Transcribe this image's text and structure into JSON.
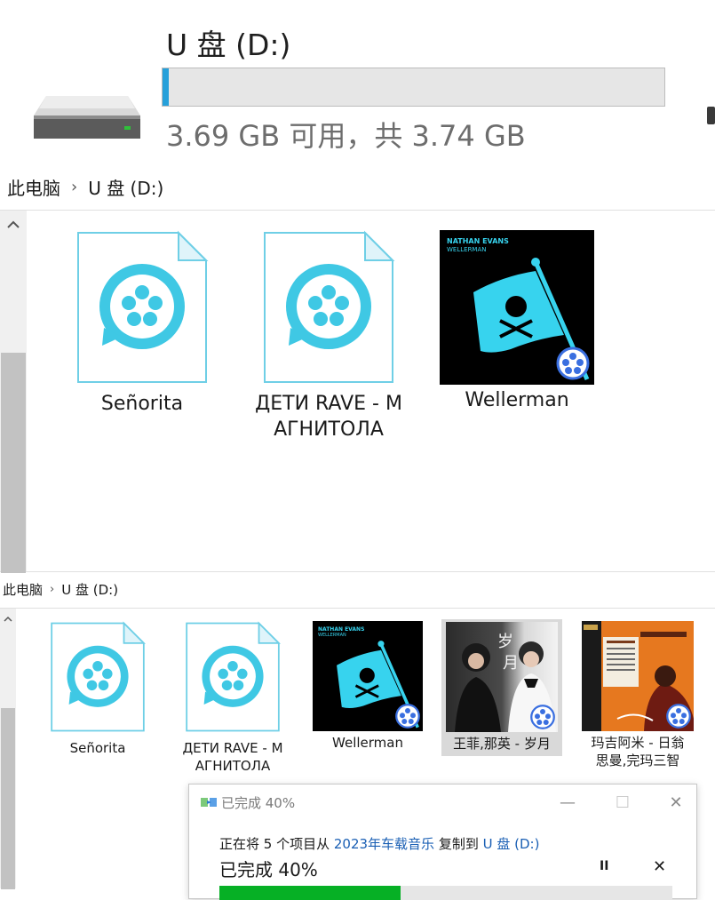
{
  "drive": {
    "title": "U 盘 (D:)",
    "space_text": "3.69 GB 可用，共 3.74 GB",
    "used_fraction": 0.013
  },
  "breadcrumb_top": {
    "root": "此电脑",
    "sep": "›",
    "current": "U 盘 (D:)"
  },
  "pane_top": {
    "items": [
      {
        "name": "Señorita",
        "icon": "video-file-icon"
      },
      {
        "name": "ДЕТИ RAVE - МАГНИТОЛА",
        "line1": "ДЕТИ RAVE - M",
        "line2": "АГНИТОЛА",
        "icon": "video-file-icon"
      },
      {
        "name": "Wellerman",
        "icon": "album-art-thumbnail",
        "cover_artist": "NATHAN EVANS",
        "cover_title": "WELLERMAN"
      }
    ]
  },
  "breadcrumb_bottom": {
    "root": "此电脑",
    "sep": "›",
    "current": "U 盘 (D:)"
  },
  "pane_bottom": {
    "items": [
      {
        "name": "Señorita",
        "icon": "video-file-icon"
      },
      {
        "name": "ДЕТИ RAVE - МАГНИТОЛА",
        "line1": "ДЕТИ RAVE - M",
        "line2": "АГНИТОЛА",
        "icon": "video-file-icon"
      },
      {
        "name": "Wellerman",
        "icon": "album-art-thumbnail",
        "cover_artist": "NATHAN EVANS",
        "cover_title": "WELLERMAN"
      },
      {
        "name": "王菲,那英 - 岁月",
        "icon": "album-art-thumbnail",
        "selected": true
      },
      {
        "name": "玛吉阿米 - 日翁思曼,完玛三智",
        "line1": "玛吉阿米 - 日翁",
        "line2": "思曼,完玛三智",
        "icon": "album-art-thumbnail"
      }
    ]
  },
  "copy_dialog": {
    "title": "已完成 40%",
    "line_prefix": "正在将 5 个项目从 ",
    "source": "2023年车载音乐",
    "line_mid": " 复制到 ",
    "destination": "U 盘 (D:)",
    "progress_text": "已完成 40%",
    "progress": 0.4,
    "pause_label": "II",
    "cancel_label": "✕",
    "minimize_label": "—",
    "maximize_label": "☐",
    "close_label": "✕"
  },
  "colors": {
    "accent_blue": "#26a0da",
    "icon_cyan": "#3fc8e4",
    "progress_green": "#06b025",
    "link_blue": "#1a5fb4"
  }
}
